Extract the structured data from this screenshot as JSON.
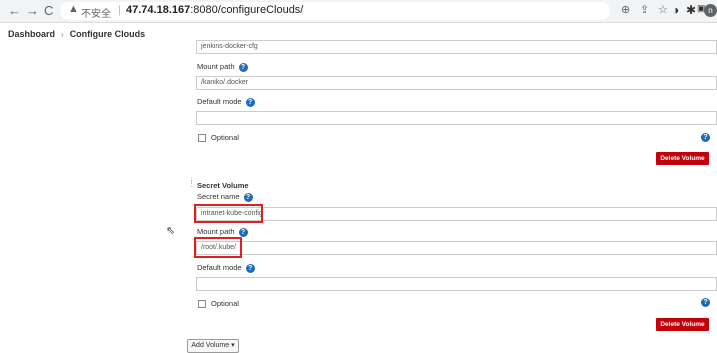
{
  "browser": {
    "back_icon": "arrow-left-icon",
    "forward_icon": "arrow-right-icon",
    "reload_icon": "reload-icon",
    "security_label": "不安全",
    "url_host": "47.74.18.167",
    "url_rest": ":8080/configureClouds/",
    "profile_initial": "n"
  },
  "breadcrumb": {
    "dashboard": "Dashboard",
    "configure_clouds": "Configure Clouds"
  },
  "volume1": {
    "secret_name_value": "jenkins-docker-cfg",
    "mount_path_label": "Mount path",
    "mount_path_value": "/kaniko/.docker",
    "default_mode_label": "Default mode",
    "default_mode_value": "",
    "optional_label": "Optional",
    "delete_label": "Delete Volume"
  },
  "volume2": {
    "header": "Secret Volume",
    "secret_name_label": "Secret name",
    "secret_name_value": "intranet-kube-config",
    "mount_path_label": "Mount path",
    "mount_path_value": "/root/.kube/",
    "default_mode_label": "Default mode",
    "default_mode_value": "",
    "optional_label": "Optional",
    "delete_label": "Delete Volume"
  },
  "add_volume_label": "Add Volume ▾",
  "colors": {
    "delete_button": "#c4000a",
    "help_icon": "#1e6bb8",
    "highlight_box": "#e21f1f"
  }
}
